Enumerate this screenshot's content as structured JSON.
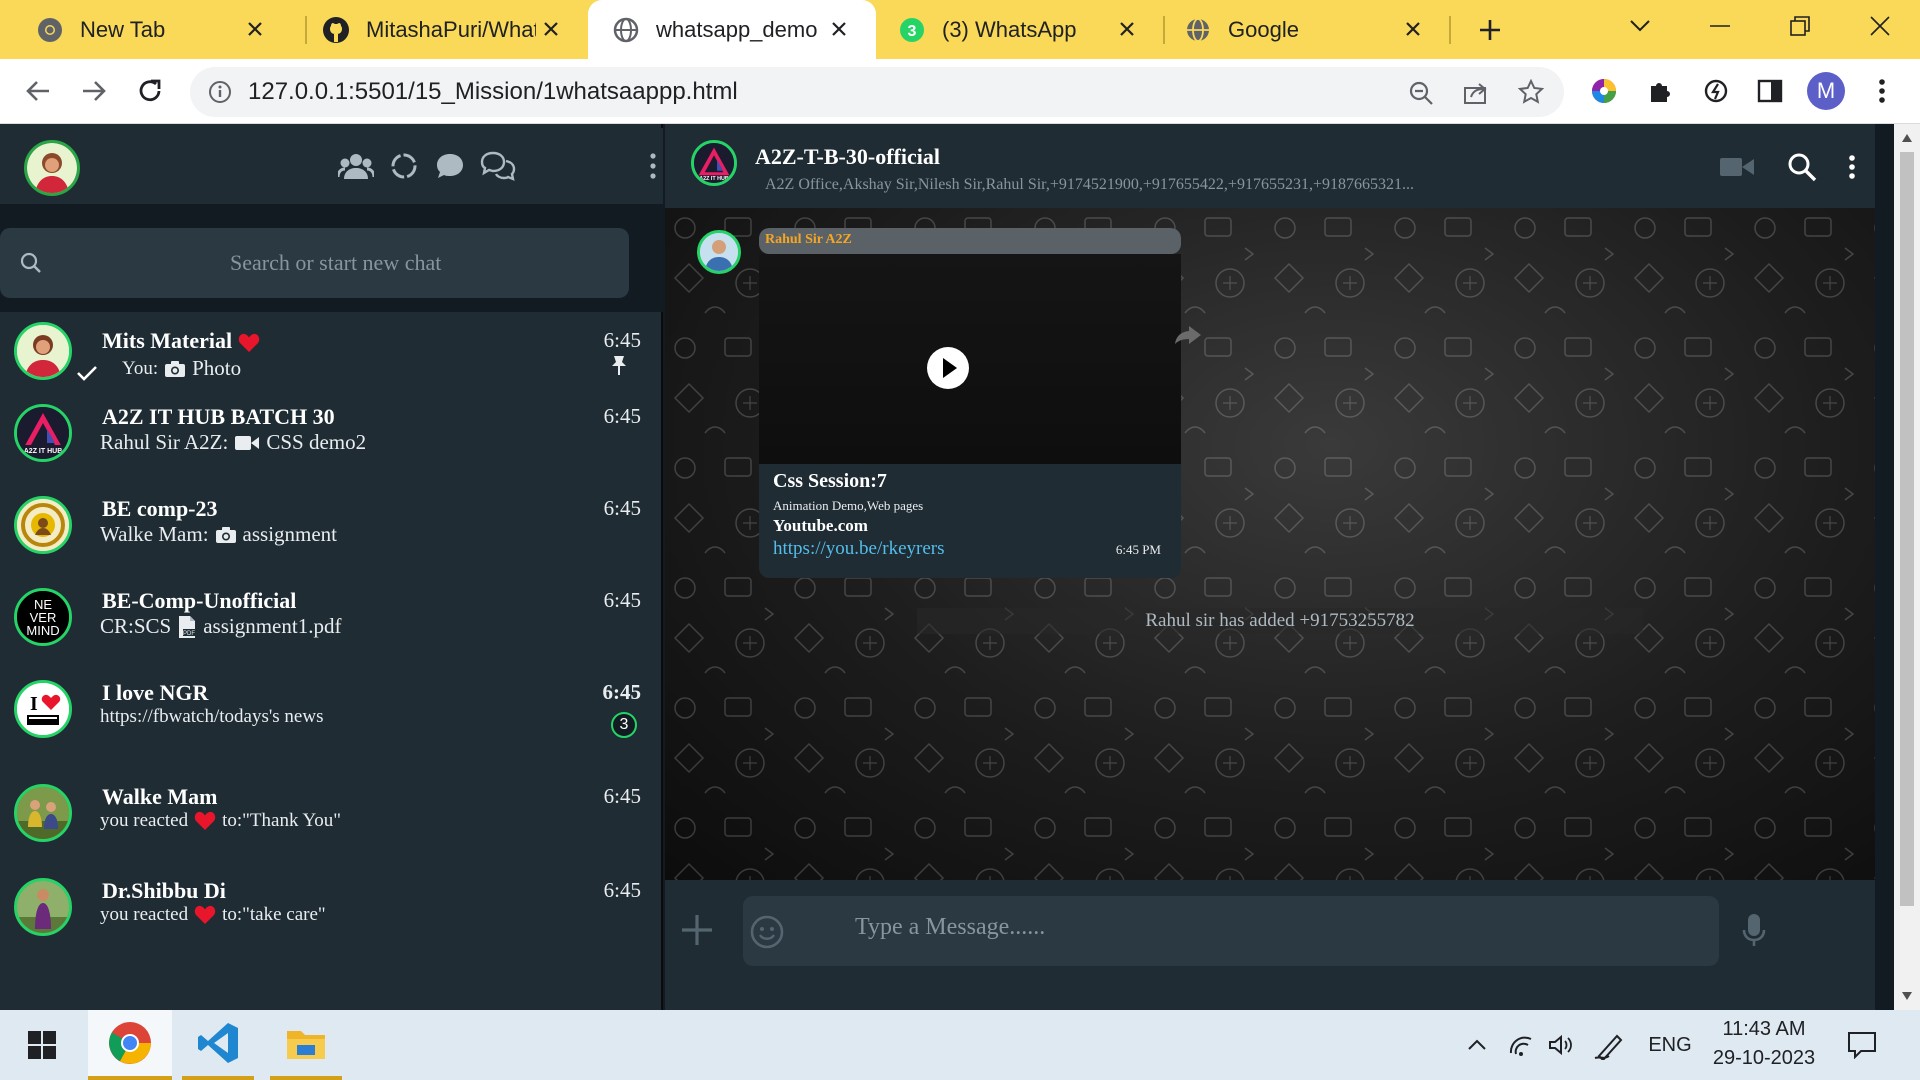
{
  "browser": {
    "tabs": [
      {
        "title": "New Tab"
      },
      {
        "title": "MitashaPuri/Whatsapp_Demo"
      },
      {
        "title": "whatsapp_demo"
      },
      {
        "title": "(3) WhatsApp"
      },
      {
        "title": "Google"
      }
    ],
    "active_tab": 2,
    "url": "127.0.0.1:5501/15_Mission/1whatsaappp.html",
    "profile_initial": "M",
    "accent": "#f9d957"
  },
  "sidebar": {
    "search_placeholder": "Search or start new chat",
    "chats": [
      {
        "name": "Mits Material",
        "message": "Photo",
        "prefix": "You:",
        "time": "6:45",
        "pinned": true
      },
      {
        "name": "A2Z IT HUB BATCH 30",
        "prefix": "Rahul Sir A2Z:",
        "message": "CSS demo2",
        "time": "6:45"
      },
      {
        "name": "BE comp-23",
        "prefix": "Walke Mam:",
        "message": "assignment",
        "time": "6:45"
      },
      {
        "name": "BE-Comp-Unofficial",
        "prefix": "CR:SCS",
        "message": "assignment1.pdf",
        "time": "6:45"
      },
      {
        "name": "I love NGR",
        "message": "https://fbwatch/todays's news",
        "time": "6:45",
        "unread": "3"
      },
      {
        "name": "Walke Mam",
        "prefix": "you reacted",
        "message": "to:\"Thank You\"",
        "time": "6:45"
      },
      {
        "name": "Dr.Shibbu Di",
        "prefix": "you reacted",
        "message": "to:\"take care\"",
        "time": "6:45"
      }
    ]
  },
  "conversation": {
    "group_name": "A2Z-T-B-30-official",
    "members": "A2Z Office,Akshay Sir,Nilesh Sir,Rahul Sir,+9174521900,+917655422,+917655231,+9187665321...",
    "message": {
      "sender": "Rahul Sir A2Z",
      "title": "Css Session:7",
      "subtitle": "Animation Demo,Web pages",
      "site": "Youtube.com",
      "link": "https://you.be/rkeyrers",
      "time": "6:45 PM"
    },
    "system_note": "Rahul sir has added +91753255782",
    "input_placeholder": "Type a Message......"
  },
  "taskbar": {
    "language": "ENG",
    "time": "11:43 AM",
    "date": "29-10-2023"
  }
}
